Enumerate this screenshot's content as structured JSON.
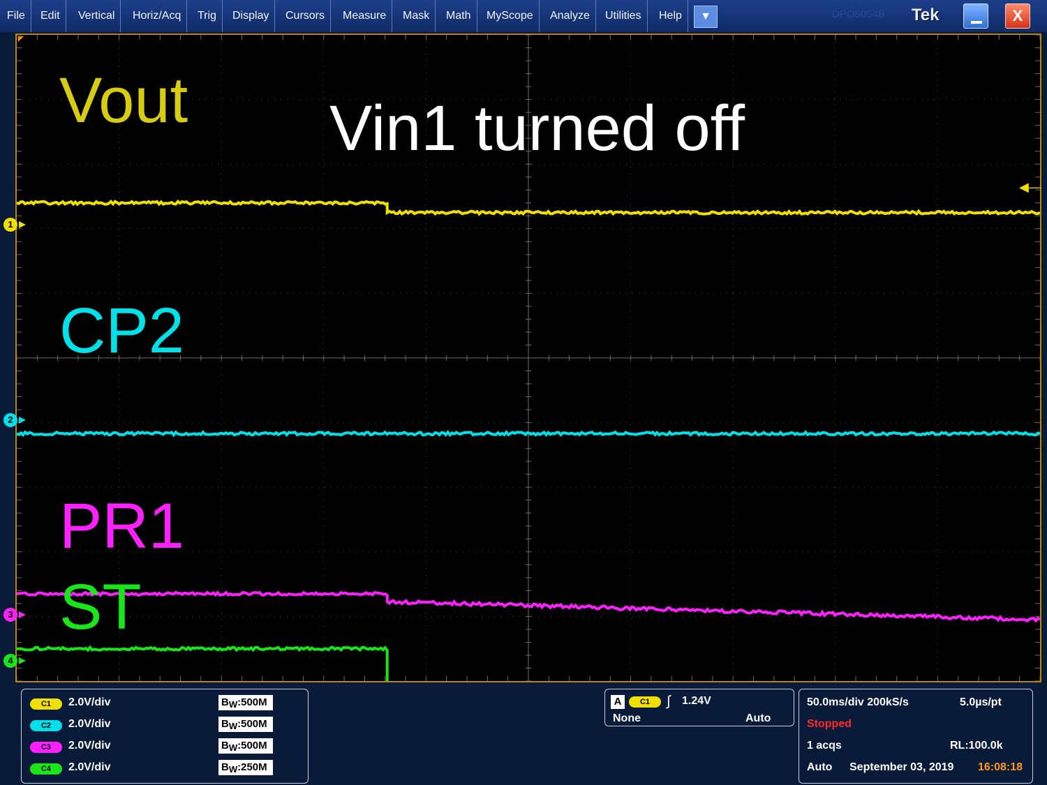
{
  "menu": [
    "File",
    "Edit",
    "Vertical",
    "Horiz/Acq",
    "Trig",
    "Display",
    "Cursors",
    "Measure",
    "Mask",
    "Math",
    "MyScope",
    "Analyze",
    "Utilities",
    "Help"
  ],
  "titlebar": {
    "model": "DPO5054B",
    "brand": "Tek",
    "dropdown_glyph": "▼",
    "close_glyph": "X"
  },
  "colors": {
    "ch1": "#f0e000",
    "ch2": "#00e0e8",
    "ch3": "#ff20ff",
    "ch4": "#19e619"
  },
  "annotations": {
    "headline": "Vin1 turned off",
    "vout": "Vout",
    "cp2": "CP2",
    "pr1": "PR1",
    "st": "ST"
  },
  "channel_markers": [
    "1",
    "2",
    "3",
    "4"
  ],
  "channels": [
    {
      "pill": "C1",
      "scale": "2.0V/div",
      "bw_prefix": "B",
      "bw_sub": "W",
      "bw": ":500M"
    },
    {
      "pill": "C2",
      "scale": "2.0V/div",
      "bw_prefix": "B",
      "bw_sub": "W",
      "bw": ":500M"
    },
    {
      "pill": "C3",
      "scale": "2.0V/div",
      "bw_prefix": "B",
      "bw_sub": "W",
      "bw": ":500M"
    },
    {
      "pill": "C4",
      "scale": "2.0V/div",
      "bw_prefix": "B",
      "bw_sub": "W",
      "bw": ":250M"
    }
  ],
  "trigger": {
    "letter": "A",
    "source": "C1",
    "level": "1.24V",
    "coupling": "None",
    "mode": "Auto"
  },
  "acquisition": {
    "horiz": "50.0ms/div 200kS/s",
    "per_point": "5.0µs/pt",
    "state": "Stopped",
    "acqs": "1 acqs",
    "record_length": "RL:100.0k",
    "mode": "Auto",
    "date": "September 03, 2019",
    "time": "16:08:18"
  },
  "waveforms": {
    "step_fraction": 0.362,
    "vout": {
      "before_div": 7.4,
      "after_div": 7.25
    },
    "cp2": {
      "level_div": 3.83
    },
    "pr1": {
      "before_div": 1.35,
      "after_start_div": 1.23,
      "after_end_div": 0.95
    },
    "st": {
      "before_div": 0.5,
      "after_div": -0.08
    }
  }
}
